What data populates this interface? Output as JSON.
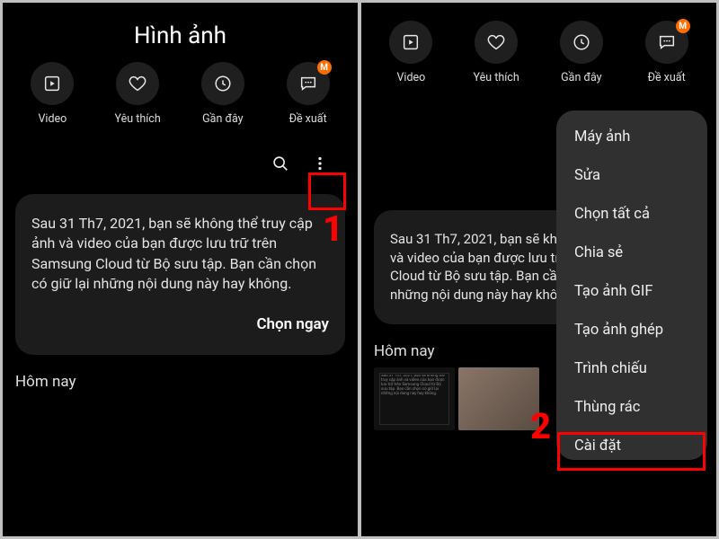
{
  "header": {
    "title": "Hình ảnh"
  },
  "tabs": [
    {
      "label": "Video"
    },
    {
      "label": "Yêu thích"
    },
    {
      "label": "Gần đây"
    },
    {
      "label": "Đề xuất",
      "badge": "M"
    }
  ],
  "notice": {
    "text": "Sau 31 Th7, 2021, bạn sẽ không thể truy cập ảnh và video của bạn được lưu trữ trên Samsung Cloud từ Bộ sưu tập. Bạn cần chọn có giữ lại những nội dung này hay không.",
    "text_clip": "Sau 31 Th7, 2021, bạn sẽ không thể truy cập ảnh và video của bạn được lưu trữ trên Samsung Cloud từ Bộ sưu tập. Bạn cần chọn có giữ lại những nội dung này hay không.",
    "action": "Chọn ngay"
  },
  "today": "Hôm nay",
  "steps": {
    "one": "1",
    "two": "2"
  },
  "menu": {
    "items": [
      "Máy ảnh",
      "Sửa",
      "Chọn tất cả",
      "Chia sẻ",
      "Tạo ảnh GIF",
      "Tạo ảnh ghép",
      "Trình chiếu",
      "Thùng rác",
      "Cài đặt"
    ]
  }
}
